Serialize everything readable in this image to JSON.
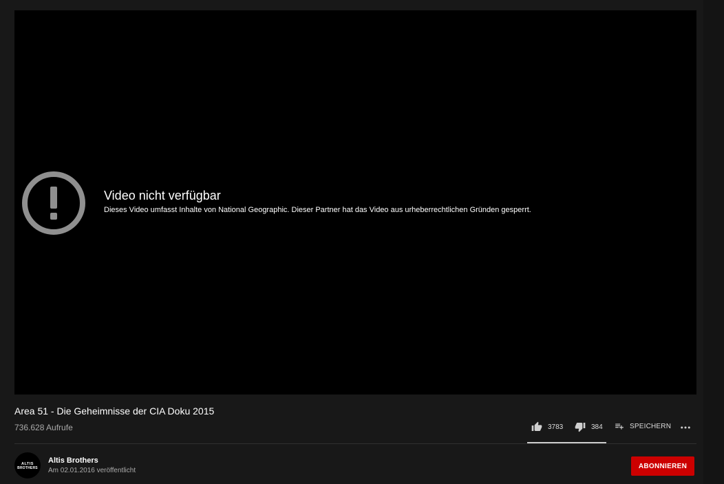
{
  "player": {
    "error_title": "Video nicht verfügbar",
    "error_reason": "Dieses Video umfasst Inhalte von National Geographic. Dieser Partner hat das Video aus urheberrechtlichen Gründen gesperrt.",
    "error_icon": "alert-circle-icon"
  },
  "video": {
    "title": "Area 51 - Die Geheimnisse der CIA Doku 2015",
    "views": "736.628 Aufrufe"
  },
  "actions": {
    "likes": "3783",
    "dislikes": "384",
    "save_label": "SPEICHERN",
    "like_ratio": 0.908
  },
  "channel": {
    "name": "Altis Brothers",
    "avatar_text": "ALTIS BROTHERS",
    "published": "Am 02.01.2016 veröffentlicht"
  },
  "subscribe": {
    "label": "ABONNIEREN"
  },
  "colors": {
    "background": "#181818",
    "player": "#000000",
    "subscribe": "#cc0000",
    "secondary_text": "#aaaaaa"
  }
}
